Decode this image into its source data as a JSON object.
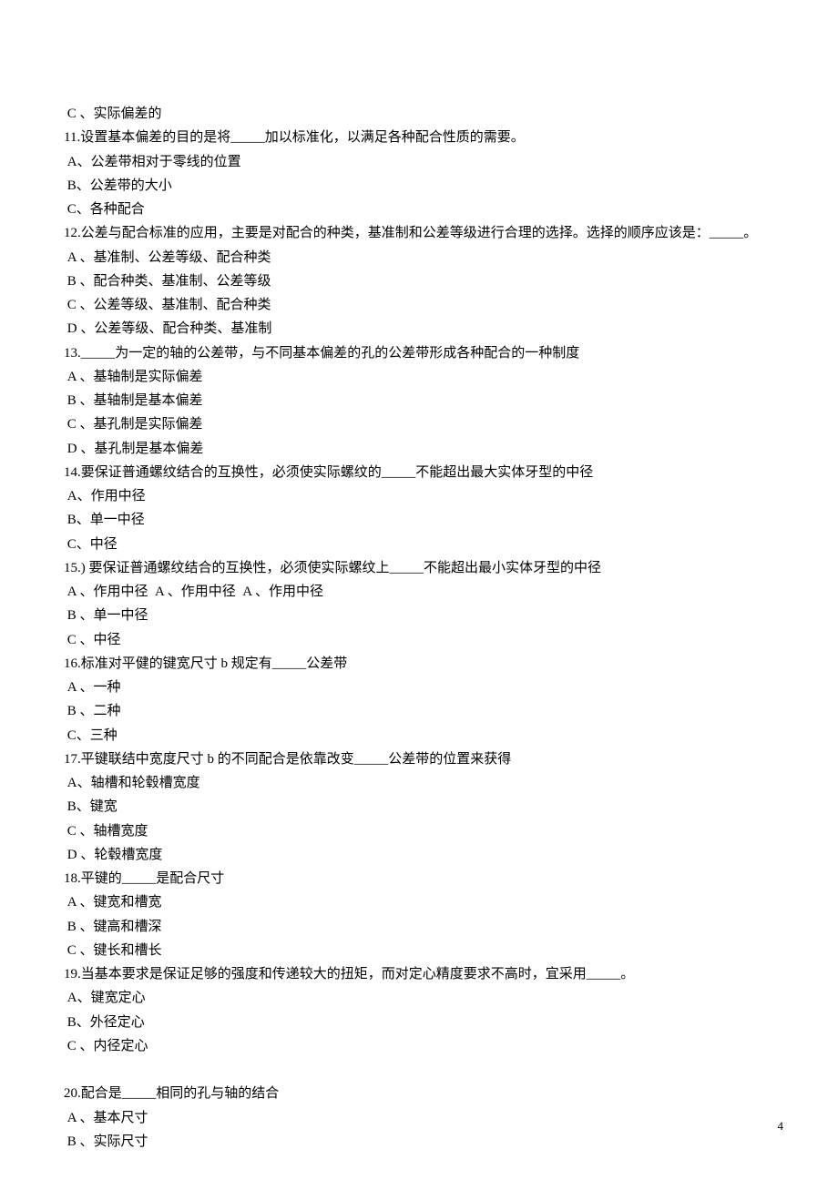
{
  "lines": [
    " C 、实际偏差的",
    "11.设置基本偏差的目的是将_____加以标准化，以满足各种配合性质的需要。",
    " A、公差带相对于零线的位置",
    " B、公差带的大小",
    " C、各种配合",
    "12.公差与配合标准的应用，主要是对配合的种类，基准制和公差等级进行合理的选择。选择的顺序应该是：_____。",
    " A 、基准制、公差等级、配合种类",
    " B 、配合种类、基准制、公差等级",
    " C 、公差等级、基准制、配合种类",
    " D 、公差等级、配合种类、基准制",
    "13._____为一定的轴的公差带，与不同基本偏差的孔的公差带形成各种配合的一种制度",
    " A 、基轴制是实际偏差",
    " B 、基轴制是基本偏差",
    " C 、基孔制是实际偏差",
    " D 、基孔制是基本偏差",
    "14.要保证普通螺纹结合的互换性，必须使实际螺纹的_____不能超出最大实体牙型的中径",
    " A、作用中径",
    " B、单一中径",
    " C、中径",
    "15.) 要保证普通螺纹结合的互换性，必须使实际螺纹上_____不能超出最小实体牙型的中径",
    " A 、作用中径  A 、作用中径  A 、作用中径",
    " B 、单一中径",
    " C 、中径",
    "16.标准对平健的键宽尺寸 b 规定有_____公差带",
    " A 、一种",
    " B 、二种",
    " C、三种",
    "17.平键联结中宽度尺寸 b 的不同配合是依靠改变_____公差带的位置来获得",
    " A、轴槽和轮毂槽宽度",
    " B、键宽",
    " C 、轴槽宽度",
    " D 、轮毂槽宽度",
    "18.平键的_____是配合尺寸",
    " A 、键宽和槽宽",
    " B 、键高和槽深",
    " C 、键长和槽长",
    "19.当基本要求是保证足够的强度和传递较大的扭矩，而对定心精度要求不高时，宜采用_____。",
    " A、键宽定心",
    " B、外径定心",
    " C 、内径定心",
    "",
    "20.配合是_____相同的孔与轴的结合",
    " A 、基本尺寸",
    " B 、实际尺寸"
  ],
  "page_number": "4"
}
